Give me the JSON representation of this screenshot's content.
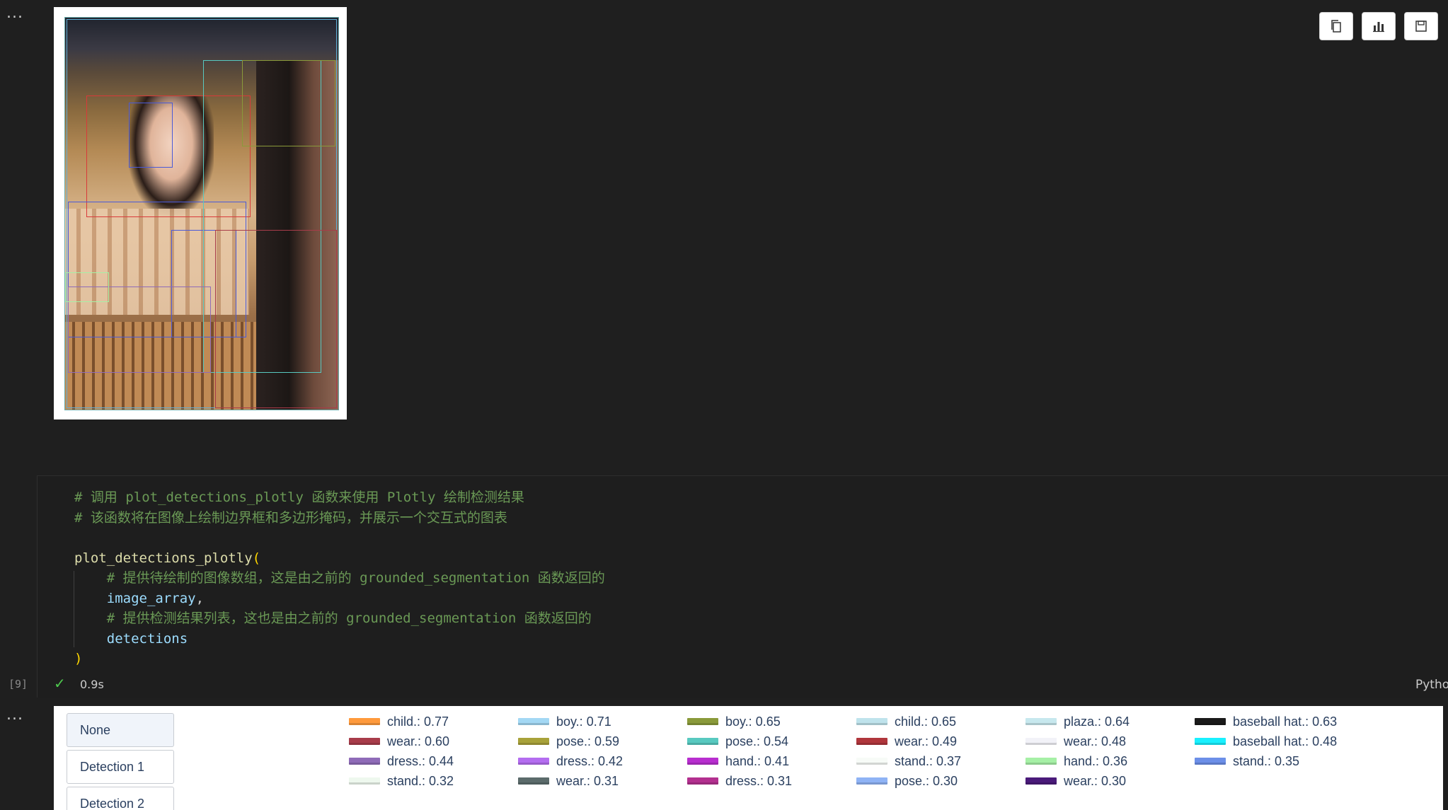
{
  "cell_menu_glyph": "...",
  "toolbar": {
    "copy_icon": "copy-icon",
    "chart_icon": "bar-chart-icon",
    "save_icon": "save-icon"
  },
  "code": {
    "lines": [
      [
        {
          "t": "# 调用 plot_detections_plotly 函数来使用 Plotly 绘制检测结果",
          "c": "comment"
        }
      ],
      [
        {
          "t": "# 该函数将在图像上绘制边界框和多边形掩码，并展示一个交互式的图表",
          "c": "comment"
        }
      ],
      [
        {
          "t": "",
          "c": "plain"
        }
      ],
      [
        {
          "t": "plot_detections_plotly",
          "c": "fn"
        },
        {
          "t": "(",
          "c": "paren"
        }
      ],
      [
        {
          "t": "    ",
          "c": "plain"
        },
        {
          "t": "# 提供待绘制的图像数组，这是由之前的 grounded_segmentation 函数返回的",
          "c": "comment"
        }
      ],
      [
        {
          "t": "    ",
          "c": "plain"
        },
        {
          "t": "image_array",
          "c": "var"
        },
        {
          "t": ",",
          "c": "plain"
        }
      ],
      [
        {
          "t": "    ",
          "c": "plain"
        },
        {
          "t": "# 提供检测结果列表，这也是由之前的 grounded_segmentation 函数返回的",
          "c": "comment"
        }
      ],
      [
        {
          "t": "    ",
          "c": "plain"
        },
        {
          "t": "detections",
          "c": "var"
        }
      ],
      [
        {
          "t": ")",
          "c": "paren"
        }
      ]
    ]
  },
  "execution": {
    "count": "[9]",
    "status_icon": "checkmark-icon",
    "duration": "0.9s",
    "kernel": "Pytho"
  },
  "plot": {
    "buttons": [
      "None",
      "Detection 1",
      "Detection 2"
    ],
    "active_button": 0,
    "legend": [
      {
        "label": "child.: 0.77",
        "color": "#ff9a3c"
      },
      {
        "label": "boy.: 0.71",
        "color": "#a3d8f4"
      },
      {
        "label": "boy.: 0.65",
        "color": "#8a9a3a"
      },
      {
        "label": "child.: 0.65",
        "color": "#bfe3ec"
      },
      {
        "label": "plaza.: 0.64",
        "color": "#c7e8ee"
      },
      {
        "label": "baseball hat.: 0.63",
        "color": "#1a1a1a"
      },
      {
        "label": "wear.: 0.60",
        "color": "#a83c4a"
      },
      {
        "label": "pose.: 0.59",
        "color": "#a8a23a"
      },
      {
        "label": "pose.: 0.54",
        "color": "#58c9c0"
      },
      {
        "label": "wear.: 0.49",
        "color": "#b0363c"
      },
      {
        "label": "wear.: 0.48",
        "color": "#f2f2f8"
      },
      {
        "label": "baseball hat.: 0.48",
        "color": "#19f0ff"
      },
      {
        "label": "dress.: 0.44",
        "color": "#8f6bb8"
      },
      {
        "label": "dress.: 0.42",
        "color": "#b46df0"
      },
      {
        "label": "hand.: 0.41",
        "color": "#b82ecf"
      },
      {
        "label": "stand.: 0.37",
        "color": "#f7fbf7"
      },
      {
        "label": "hand.: 0.36",
        "color": "#a6f0a6"
      },
      {
        "label": "stand.: 0.35",
        "color": "#6c8fe8"
      },
      {
        "label": "stand.: 0.32",
        "color": "#eef8ee"
      },
      {
        "label": "wear.: 0.31",
        "color": "#5b6b6b"
      },
      {
        "label": "dress.: 0.31",
        "color": "#b3308f"
      },
      {
        "label": "pose.: 0.30",
        "color": "#8fb3f5"
      },
      {
        "label": "wear.: 0.30",
        "color": "#4a1a7a"
      }
    ]
  }
}
